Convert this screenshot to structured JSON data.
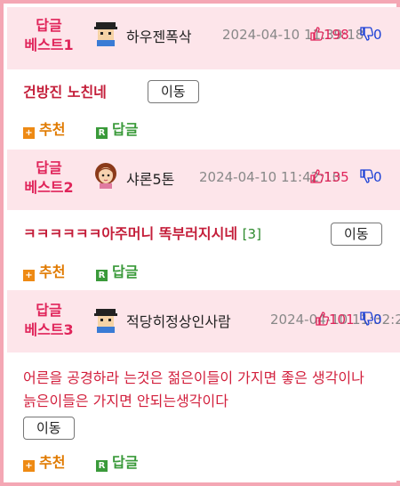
{
  "posts": [
    {
      "badge_line1": "답글",
      "badge_line2": "베스트1",
      "avatar": "blockman-avatar",
      "nickname": "하우젠폭삭",
      "date": "2024-04-10 11:39:18",
      "likes": "198",
      "dislikes": "0",
      "content": "건방진 노친네",
      "comment_count": "",
      "move_label": "이동",
      "recommend_label": "추천",
      "reply_label": "답글"
    },
    {
      "badge_line1": "답글",
      "badge_line2": "베스트2",
      "avatar": "woman-avatar",
      "nickname": "샤론5톤",
      "date": "2024-04-10 11:42:10",
      "likes": "135",
      "dislikes": "0",
      "content": "ㅋㅋㅋㅋㅋㅋ아주머니 똑부러지시네",
      "comment_count": "[3]",
      "move_label": "이동",
      "recommend_label": "추천",
      "reply_label": "답글"
    },
    {
      "badge_line1": "답글",
      "badge_line2": "베스트3",
      "avatar": "blockman-avatar",
      "nickname": "적당히정상인사람",
      "date": "2024-04-10 11:32:2",
      "likes": "101",
      "dislikes": "0",
      "content": "어른을 공경하라 는것은 젊은이들이 가지면 좋은 생각이나 늙은이들은 가지면 안되는생각이다",
      "comment_count": "",
      "move_label": "이동",
      "recommend_label": "추천",
      "reply_label": "답글"
    }
  ],
  "colors": {
    "frame": "#f4a7b4",
    "header_bg": "#fde5ea",
    "badge": "#e0245a",
    "content": "#c41e3a",
    "like": "#e0245a",
    "dislike": "#1a3fd6",
    "recommend": "#e07a00",
    "reply": "#3a9a3a"
  }
}
